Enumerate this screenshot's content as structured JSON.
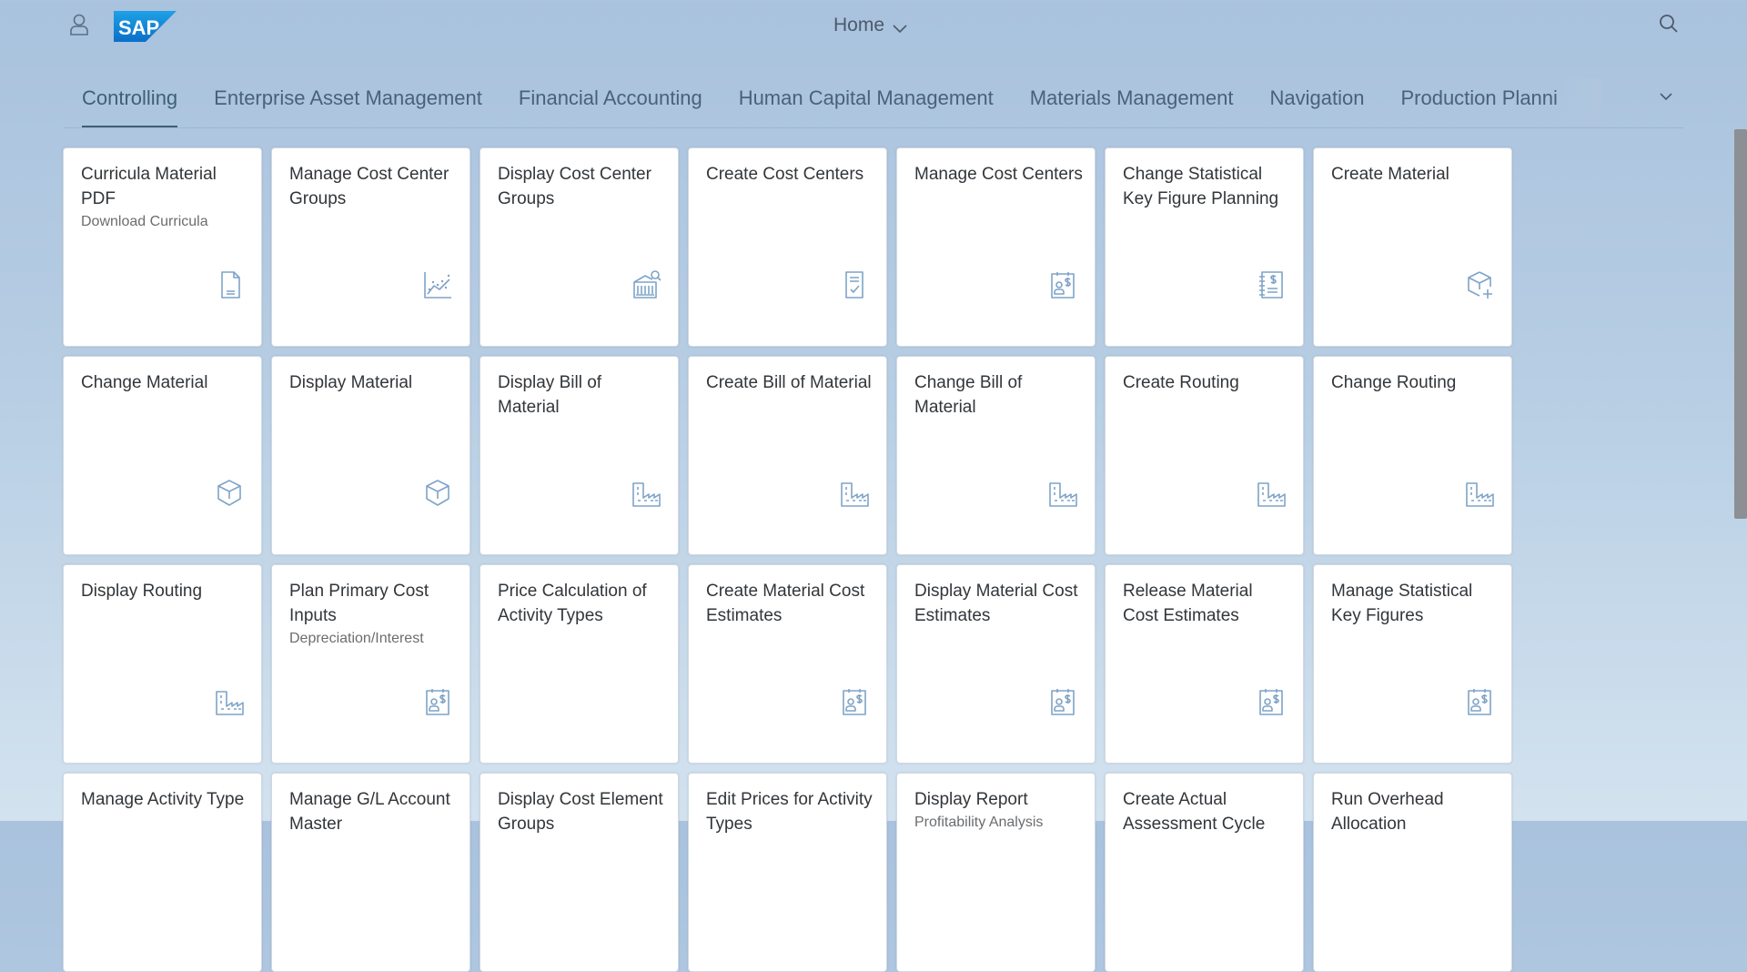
{
  "shell": {
    "title": "Home"
  },
  "tabs": [
    {
      "label": "Controlling",
      "selected": true
    },
    {
      "label": "Enterprise Asset Management"
    },
    {
      "label": "Financial Accounting"
    },
    {
      "label": "Human Capital Management"
    },
    {
      "label": "Materials Management"
    },
    {
      "label": "Navigation"
    },
    {
      "label": "Production Planni"
    }
  ],
  "tiles": [
    {
      "title": "Curricula Material PDF",
      "subtitle": "Download Curricula",
      "icon": "document-icon"
    },
    {
      "title": "Manage Cost Center Groups",
      "subtitle": "",
      "icon": "line-chart-icon"
    },
    {
      "title": "Display Cost Center Groups",
      "subtitle": "",
      "icon": "building-search-icon"
    },
    {
      "title": "Create Cost Centers",
      "subtitle": "",
      "icon": "checklist-icon"
    },
    {
      "title": "Manage Cost Centers",
      "subtitle": "",
      "icon": "cost-card-icon"
    },
    {
      "title": "Change Statistical Key Figure Planning",
      "subtitle": "",
      "icon": "notebook-dollar-icon"
    },
    {
      "title": "Create Material",
      "subtitle": "",
      "icon": "add-product-icon"
    },
    {
      "title": "Change Material",
      "subtitle": "",
      "icon": "product-box-icon"
    },
    {
      "title": "Display Material",
      "subtitle": "",
      "icon": "product-box-icon"
    },
    {
      "title": "Display Bill of Material",
      "subtitle": "",
      "icon": "factory-icon"
    },
    {
      "title": "Create Bill of Material",
      "subtitle": "",
      "icon": "factory-icon"
    },
    {
      "title": "Change Bill of Material",
      "subtitle": "",
      "icon": "factory-icon"
    },
    {
      "title": "Create Routing",
      "subtitle": "",
      "icon": "factory-icon"
    },
    {
      "title": "Change Routing",
      "subtitle": "",
      "icon": "factory-icon"
    },
    {
      "title": "Display Routing",
      "subtitle": "",
      "icon": "factory-icon"
    },
    {
      "title": "Plan Primary Cost Inputs",
      "subtitle": "Depreciation/Interest",
      "icon": "cost-card-icon"
    },
    {
      "title": "Price Calculation of Activity Types",
      "subtitle": "",
      "icon": ""
    },
    {
      "title": "Create Material Cost Estimates",
      "subtitle": "",
      "icon": "cost-card-icon"
    },
    {
      "title": "Display Material Cost Estimates",
      "subtitle": "",
      "icon": "cost-card-icon"
    },
    {
      "title": "Release Material Cost Estimates",
      "subtitle": "",
      "icon": "cost-card-icon"
    },
    {
      "title": "Manage Statistical Key Figures",
      "subtitle": "",
      "icon": "cost-card-icon"
    },
    {
      "title": "Manage Activity Type",
      "subtitle": "",
      "icon": ""
    },
    {
      "title": "Manage G/L Account Master",
      "subtitle": "",
      "icon": ""
    },
    {
      "title": "Display Cost Element Groups",
      "subtitle": "",
      "icon": ""
    },
    {
      "title": "Edit Prices for Activity Types",
      "subtitle": "",
      "icon": ""
    },
    {
      "title": "Display Report",
      "subtitle": "Profitability Analysis",
      "icon": ""
    },
    {
      "title": "Create Actual Assessment Cycle",
      "subtitle": "",
      "icon": ""
    },
    {
      "title": "Run Overhead Allocation",
      "subtitle": "",
      "icon": ""
    }
  ],
  "colors": {
    "icon": "#7fa3c7",
    "accent": "#3e5f7a"
  }
}
